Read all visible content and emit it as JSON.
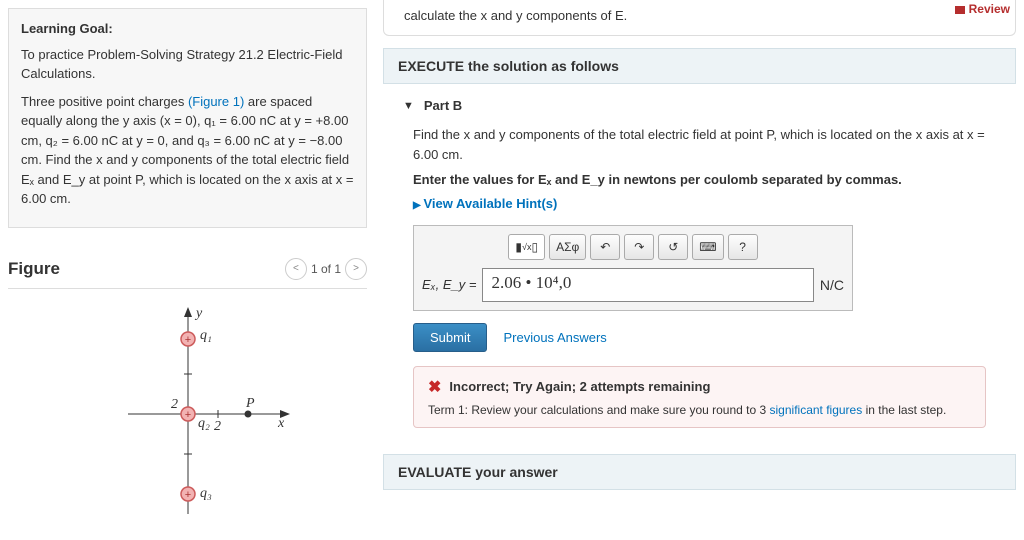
{
  "review_link": "Review",
  "learning": {
    "title": "Learning Goal:",
    "goal": "To practice Problem-Solving Strategy 21.2 Electric-Field Calculations.",
    "problem_lead": "Three positive point charges ",
    "figure_link": "(Figure 1)",
    "problem_rest": " are spaced equally along the y axis (x = 0), q₁ = 6.00 nC at y = +8.00 cm, q₂ = 6.00 nC at y = 0, and q₃ = 6.00 nC at y = −8.00 cm.   Find the x and y components of the total electric field Eₓ and E_y at point P, which is located on the x axis at x = 6.00 cm."
  },
  "figure": {
    "heading": "Figure",
    "page": "1 of 1"
  },
  "calc_bar": "calculate the x and y components of E.",
  "execute": "EXECUTE the solution as follows",
  "partB": {
    "title": "Part B",
    "prompt": "Find the x and y components of the total electric field at point P, which is located on the x axis at x = 6.00 cm.",
    "instruction": "Enter the values for Eₓ and E_y in newtons per coulomb separated by commas.",
    "hints": "View Available Hint(s)",
    "lhs": "Eₓ, E_y =",
    "answer": "2.06 • 10⁴,0",
    "unit": "N/C",
    "submit": "Submit",
    "prev": "Previous Answers"
  },
  "feedback": {
    "title": "Incorrect; Try Again; 2 attempts remaining",
    "msg_pre": "Term 1: Review your calculations and make sure you round to 3 ",
    "msg_link": "significant figures",
    "msg_post": " in the last step."
  },
  "evaluate": "EVALUATE your answer",
  "toolbar": {
    "sym": "ΑΣφ",
    "help": "?"
  }
}
